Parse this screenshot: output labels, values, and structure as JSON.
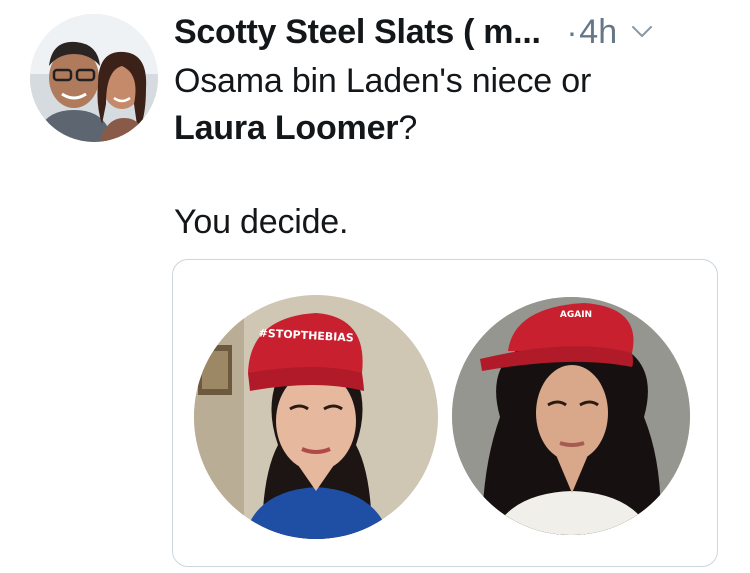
{
  "tweet": {
    "author": {
      "display_name": "Scotty Steel Slats ( m...",
      "avatar_icon": "user-avatar-photo"
    },
    "separator": "·",
    "timestamp": "4h",
    "menu_icon": "chevron-down-icon",
    "text": {
      "line1": "Osama bin Laden's niece or",
      "mention": "Laura Loomer",
      "line2_suffix": "?",
      "line3": "You decide."
    },
    "media": {
      "left_photo": {
        "hat_text": "#STOPTHEBIAS"
      },
      "right_photo": {
        "hat_text": "AGAIN"
      }
    }
  },
  "colors": {
    "text_primary": "#14171a",
    "text_secondary": "#657786",
    "card_border": "#ccd6dd",
    "hat_red": "#c8202f"
  }
}
